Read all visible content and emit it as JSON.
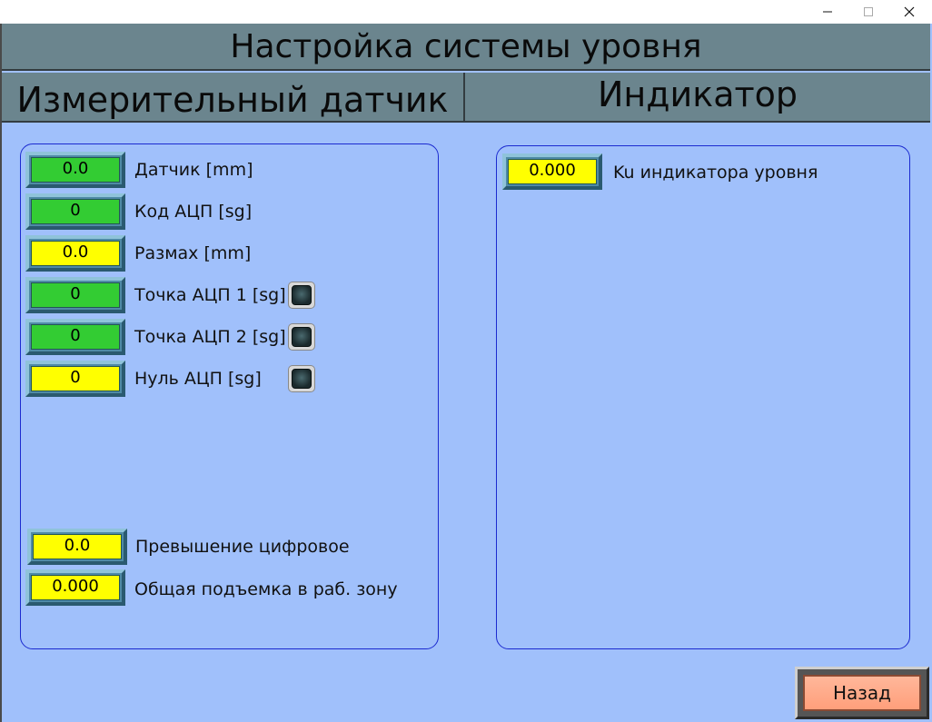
{
  "window": {
    "minimize_icon": "minimize-icon",
    "maximize_icon": "maximize-icon",
    "close_icon": "close-icon"
  },
  "header": {
    "title": "Настройка системы уровня"
  },
  "tabs": [
    {
      "label": "Измерительный датчик"
    },
    {
      "label": "Индикатор"
    }
  ],
  "sensor": {
    "rows": [
      {
        "value": "0.0",
        "label": "Датчик [mm]",
        "color": "green"
      },
      {
        "value": "0",
        "label": "Код АЦП [sg]",
        "color": "green"
      },
      {
        "value": "0.0",
        "label": "Размах [mm]",
        "color": "yellow"
      },
      {
        "value": "0",
        "label": "Точка АЦП 1 [sg]",
        "color": "green"
      },
      {
        "value": "0",
        "label": "Точка АЦП 2 [sg]",
        "color": "green"
      },
      {
        "value": "0",
        "label": "Нуль АЦП [sg]",
        "color": "yellow"
      }
    ],
    "bottom_rows": [
      {
        "value": "0.0",
        "label": "Превышение цифровое",
        "color": "yellow"
      },
      {
        "value": "0.000",
        "label": "Общая подъемка в раб. зону",
        "color": "yellow"
      }
    ]
  },
  "indicator": {
    "rows": [
      {
        "value": "0.000",
        "label": "Ku индикатора уровня",
        "color": "yellow"
      }
    ]
  },
  "footer": {
    "back_label": "Назад"
  },
  "colors": {
    "background": "#a0c0fb",
    "header": "#6b858e",
    "field_green": "#33cc33",
    "field_yellow": "#ffff00",
    "panel_border": "#1b2ad0",
    "back_button": "#ffa985"
  }
}
